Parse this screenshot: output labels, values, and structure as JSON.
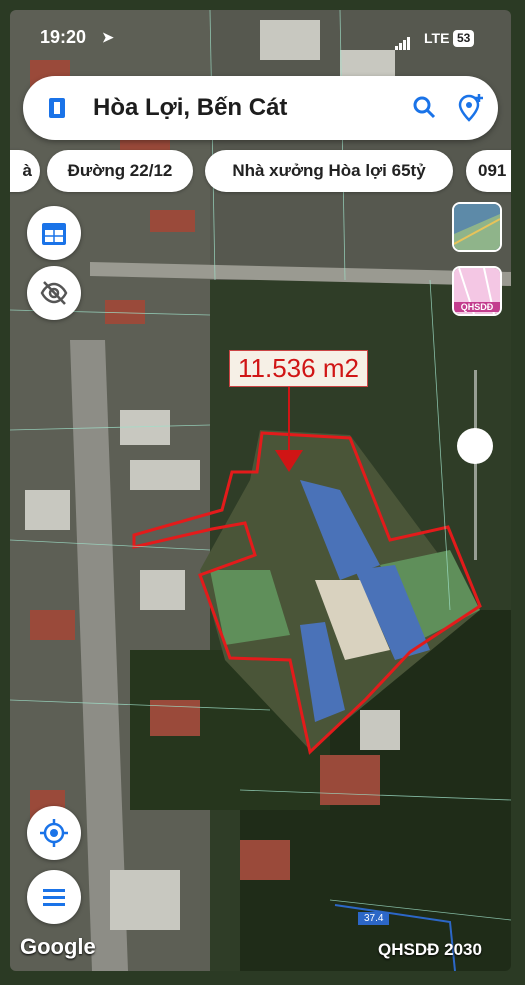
{
  "status_bar": {
    "time": "19:20",
    "network": "LTE",
    "battery": "53"
  },
  "search": {
    "title": "Hòa Lợi, Bến Cát"
  },
  "chips": [
    "à",
    "Đường 22/12",
    "Nhà xưởng Hòa lợi 65tỷ",
    "091"
  ],
  "map": {
    "area_label": "11.536 m2",
    "scale_label": "37.4",
    "footer_label": "QHSDĐ 2030",
    "google_label": "Google"
  },
  "layers": {
    "thumb_label": "QHSDĐ"
  },
  "colors": {
    "boundary": "#e31b1b",
    "accent": "#1a73e8",
    "area_text": "#d01515"
  }
}
